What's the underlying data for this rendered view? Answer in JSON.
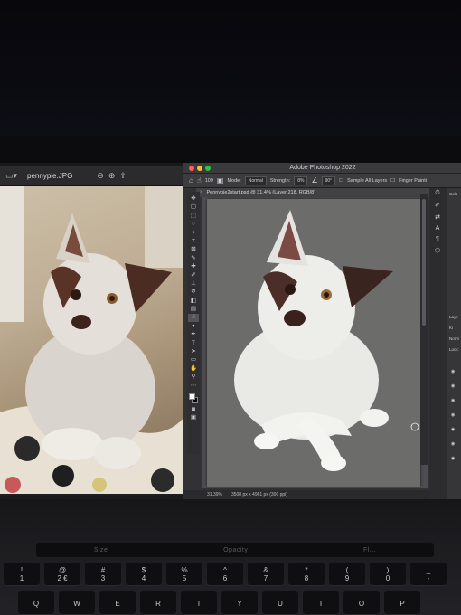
{
  "preview": {
    "title": "pennypie.JPG",
    "icons": [
      "sidebar-icon",
      "zoom-out-icon",
      "zoom-in-icon",
      "share-icon"
    ]
  },
  "photoshop": {
    "app_title": "Adobe Photoshop 2022",
    "options": {
      "brush_size": "109",
      "mode_label": "Mode:",
      "mode_value": "Normal",
      "strength_label": "Strength:",
      "strength_value": "8%",
      "angle_value": "90°",
      "sample_all_layers": "Sample All Layers",
      "finger_painting": "Finger Painti"
    },
    "document_tab": "Pennypie2start.psd @ 31.4% (Layer 218, RGB/8)",
    "status": {
      "zoom": "31.39%",
      "dimensions": "3508 px x 4961 px (300 ppi)"
    },
    "panels": {
      "color_label": "Colo",
      "layers_label": "Laye",
      "kind_label": "Ki",
      "normal_label": "Norm",
      "lock_label": "Lock:"
    }
  },
  "touchbar": {
    "size": "Size",
    "opacity": "Opacity",
    "extra": "Fl..."
  },
  "keyboard": {
    "row1": [
      {
        "top": "!",
        "bottom": "1"
      },
      {
        "top": "@",
        "bottom": "2 €"
      },
      {
        "top": "#",
        "bottom": "3"
      },
      {
        "top": "$",
        "bottom": "4"
      },
      {
        "top": "%",
        "bottom": "5"
      },
      {
        "top": "^",
        "bottom": "6"
      },
      {
        "top": "&",
        "bottom": "7"
      },
      {
        "top": "*",
        "bottom": "8"
      },
      {
        "top": "(",
        "bottom": "9"
      },
      {
        "top": ")",
        "bottom": "0"
      },
      {
        "top": "_",
        "bottom": "-"
      }
    ],
    "row2": [
      "Q",
      "W",
      "E",
      "R",
      "T",
      "Y",
      "U",
      "I",
      "O",
      "P"
    ]
  },
  "colors": {
    "ps_chrome": "#323234",
    "canvas_bg": "#6c6d6b",
    "close": "#ff5f57",
    "minimize": "#febc2e",
    "zoom": "#28c840"
  }
}
